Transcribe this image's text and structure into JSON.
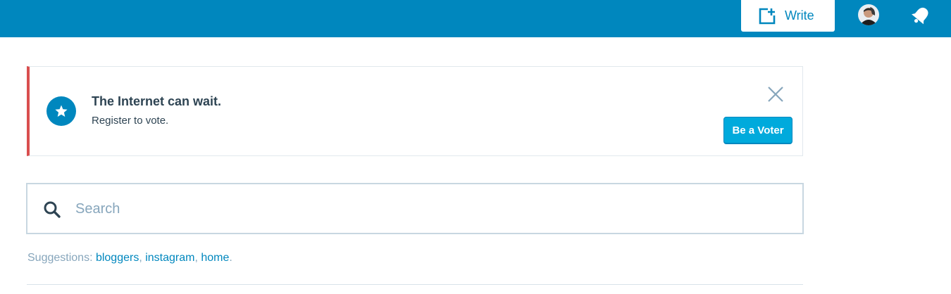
{
  "masterbar": {
    "write_label": "Write",
    "write_icon": "add-post-icon",
    "avatar_icon": "user-avatar",
    "notifications_icon": "bell-icon",
    "background_color": "#0087be"
  },
  "banner": {
    "icon": "star-icon",
    "title": "The Internet can wait.",
    "description": "Register to vote.",
    "cta_label": "Be a Voter",
    "close_icon": "close-icon",
    "accent_color": "#d94f4f"
  },
  "search": {
    "placeholder": "Search",
    "value": "",
    "icon": "search-icon"
  },
  "suggestions": {
    "prefix": "Suggestions: ",
    "items": [
      "bloggers",
      "instagram",
      "home"
    ],
    "separator": ", ",
    "suffix": "."
  }
}
